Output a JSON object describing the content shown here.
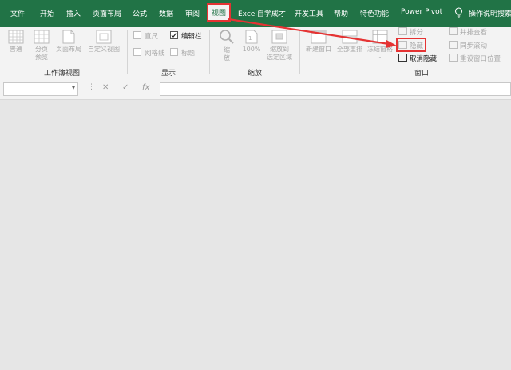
{
  "tabs": [
    {
      "label": "文件"
    },
    {
      "label": "开始"
    },
    {
      "label": "插入"
    },
    {
      "label": "页面布局"
    },
    {
      "label": "公式"
    },
    {
      "label": "数据"
    },
    {
      "label": "审阅"
    },
    {
      "label": "视图",
      "active": true
    },
    {
      "label": "Excel自学成才"
    },
    {
      "label": "开发工具"
    },
    {
      "label": "帮助"
    },
    {
      "label": "特色功能"
    },
    {
      "label": "Power Pivot"
    }
  ],
  "tell_me": {
    "label": "操作说明搜索"
  },
  "groups": {
    "workbook_views": {
      "label": "工作簿视图",
      "buttons": [
        {
          "label": "普通"
        },
        {
          "label1": "分页",
          "label2": "预览"
        },
        {
          "label": "页面布局"
        },
        {
          "label": "自定义视图"
        }
      ]
    },
    "show": {
      "label": "显示",
      "items": [
        {
          "label": "直尺",
          "checked": false
        },
        {
          "label": "编辑栏",
          "checked": true
        },
        {
          "label": "网格线",
          "checked": false
        },
        {
          "label": "标题",
          "checked": false
        }
      ]
    },
    "zoom": {
      "label": "缩放",
      "buttons": [
        {
          "label1": "缩",
          "label2": "放"
        },
        {
          "label": "100%"
        },
        {
          "label1": "缩放到",
          "label2": "选定区域"
        }
      ]
    },
    "window": {
      "label": "窗口",
      "buttons": [
        {
          "label": "新建窗口"
        },
        {
          "label": "全部重排"
        },
        {
          "label1": "冻结窗格",
          "label2": "-"
        }
      ],
      "small_mid": [
        {
          "label": "拆分"
        },
        {
          "label": "隐藏"
        },
        {
          "label": "取消隐藏"
        }
      ],
      "small_right": [
        {
          "label": "并排查看"
        },
        {
          "label": "同步滚动"
        },
        {
          "label": "重设窗口位置"
        }
      ]
    }
  },
  "formula_bar": {
    "cancel_glyph": "✕",
    "enter_glyph": "✓",
    "fx_glyph": "fx",
    "namebox_arrow": "▾"
  },
  "colors": {
    "accent": "#217346",
    "highlight": "#e53333"
  }
}
